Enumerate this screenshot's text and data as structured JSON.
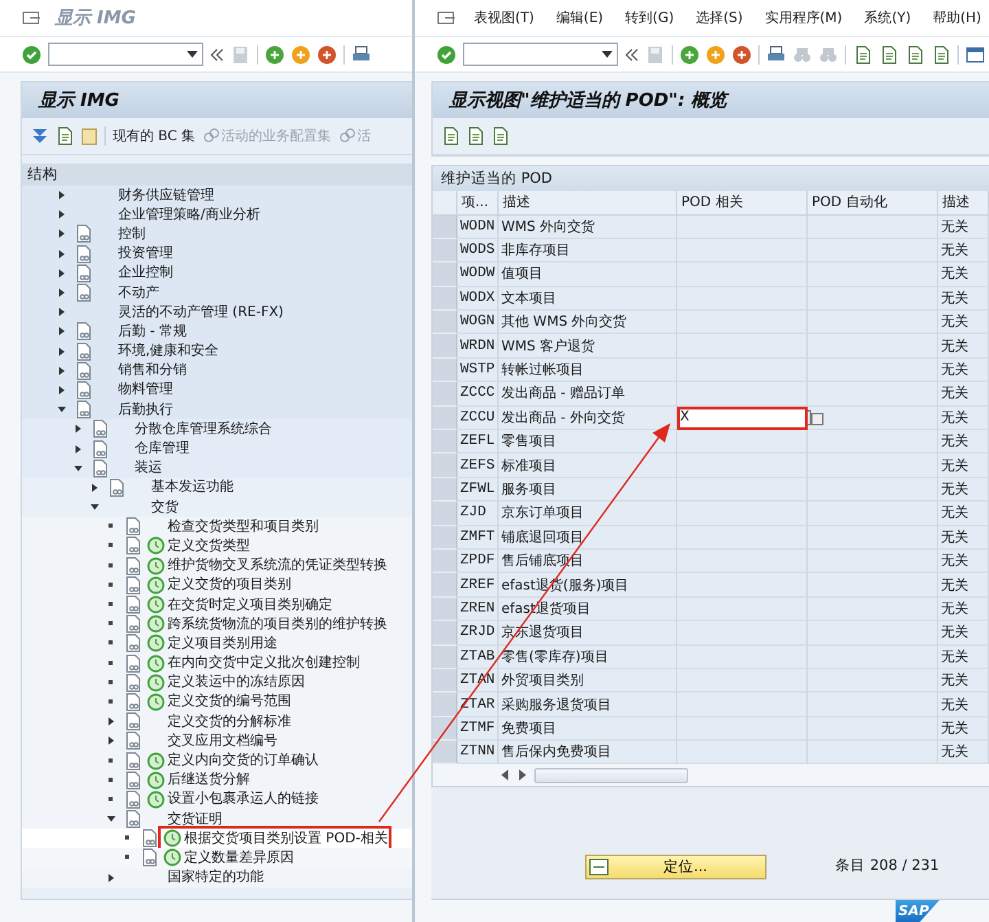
{
  "left_window": {
    "title": "显示 IMG",
    "panel_title": "显示 IMG",
    "toolbar": [
      {
        "label": "现有的 BC 集",
        "disabled": false
      },
      {
        "label": "活动的业务配置集",
        "disabled": true
      },
      {
        "label": "活",
        "disabled": true
      }
    ],
    "structure_label": "结构",
    "tree": [
      {
        "label": "财务供应链管理",
        "kind": "node",
        "expanded": false,
        "doc": false,
        "execute": false,
        "highlighted": false
      },
      {
        "label": "企业管理策略/商业分析",
        "kind": "node",
        "expanded": false,
        "doc": false,
        "execute": false,
        "highlighted": false
      },
      {
        "label": "控制",
        "kind": "node",
        "expanded": false,
        "doc": true,
        "execute": false,
        "highlighted": false
      },
      {
        "label": "投资管理",
        "kind": "node",
        "expanded": false,
        "doc": true,
        "execute": false,
        "highlighted": false
      },
      {
        "label": "企业控制",
        "kind": "node",
        "expanded": false,
        "doc": true,
        "execute": false,
        "highlighted": false
      },
      {
        "label": "不动产",
        "kind": "node",
        "expanded": false,
        "doc": true,
        "execute": false,
        "highlighted": false
      },
      {
        "label": "灵活的不动产管理 (RE-FX)",
        "kind": "node",
        "expanded": false,
        "doc": false,
        "execute": false,
        "highlighted": false
      },
      {
        "label": "后勤 - 常规",
        "kind": "node",
        "expanded": false,
        "doc": true,
        "execute": false,
        "highlighted": false
      },
      {
        "label": "环境,健康和安全",
        "kind": "node",
        "expanded": false,
        "doc": true,
        "execute": false,
        "highlighted": false
      },
      {
        "label": "销售和分销",
        "kind": "node",
        "expanded": false,
        "doc": true,
        "execute": false,
        "highlighted": false
      },
      {
        "label": "物料管理",
        "kind": "node",
        "expanded": false,
        "doc": true,
        "execute": false,
        "highlighted": false
      },
      {
        "label": "后勤执行",
        "kind": "node",
        "expanded": true,
        "doc": true,
        "execute": false,
        "highlighted": false,
        "children": [
          {
            "label": "分散仓库管理系统综合",
            "kind": "node",
            "expanded": false,
            "doc": true,
            "execute": false,
            "highlighted": false
          },
          {
            "label": "仓库管理",
            "kind": "node",
            "expanded": false,
            "doc": true,
            "execute": false,
            "highlighted": false
          },
          {
            "label": "装运",
            "kind": "node",
            "expanded": true,
            "doc": true,
            "execute": false,
            "highlighted": false,
            "children": [
              {
                "label": "基本发运功能",
                "kind": "node",
                "expanded": false,
                "doc": true,
                "execute": false,
                "highlighted": false
              },
              {
                "label": "交货",
                "kind": "node",
                "expanded": true,
                "doc": false,
                "execute": false,
                "highlighted": false,
                "children": [
                  {
                    "label": "检查交货类型和项目类别",
                    "kind": "leaf",
                    "doc": true,
                    "execute": false,
                    "highlighted": false
                  },
                  {
                    "label": "定义交货类型",
                    "kind": "leaf",
                    "doc": true,
                    "execute": true,
                    "highlighted": false
                  },
                  {
                    "label": "维护货物交叉系统流的凭证类型转换",
                    "kind": "leaf",
                    "doc": true,
                    "execute": true,
                    "highlighted": false
                  },
                  {
                    "label": "定义交货的项目类别",
                    "kind": "leaf",
                    "doc": true,
                    "execute": true,
                    "highlighted": false
                  },
                  {
                    "label": "在交货时定义项目类别确定",
                    "kind": "leaf",
                    "doc": true,
                    "execute": true,
                    "highlighted": false
                  },
                  {
                    "label": "跨系统货物流的项目类别的维护转换",
                    "kind": "leaf",
                    "doc": true,
                    "execute": true,
                    "highlighted": false
                  },
                  {
                    "label": "定义项目类别用途",
                    "kind": "leaf",
                    "doc": true,
                    "execute": true,
                    "highlighted": false
                  },
                  {
                    "label": "在内向交货中定义批次创建控制",
                    "kind": "leaf",
                    "doc": true,
                    "execute": true,
                    "highlighted": false
                  },
                  {
                    "label": "定义装运中的冻结原因",
                    "kind": "leaf",
                    "doc": true,
                    "execute": true,
                    "highlighted": false
                  },
                  {
                    "label": "定义交货的编号范围",
                    "kind": "leaf",
                    "doc": true,
                    "execute": true,
                    "highlighted": false
                  },
                  {
                    "label": "定义交货的分解标准",
                    "kind": "node",
                    "expanded": false,
                    "doc": true,
                    "execute": false,
                    "highlighted": false
                  },
                  {
                    "label": "交叉应用文档编号",
                    "kind": "node",
                    "expanded": false,
                    "doc": true,
                    "execute": false,
                    "highlighted": false
                  },
                  {
                    "label": "定义内向交货的订单确认",
                    "kind": "leaf",
                    "doc": true,
                    "execute": true,
                    "highlighted": false
                  },
                  {
                    "label": "后继送货分解",
                    "kind": "leaf",
                    "doc": true,
                    "execute": true,
                    "highlighted": false
                  },
                  {
                    "label": "设置小包裹承运人的链接",
                    "kind": "leaf",
                    "doc": true,
                    "execute": true,
                    "highlighted": false
                  },
                  {
                    "label": "交货证明",
                    "kind": "node",
                    "expanded": true,
                    "doc": true,
                    "execute": false,
                    "highlighted": false,
                    "children": [
                      {
                        "label": "根据交货项目类别设置 POD-相关",
                        "kind": "leaf",
                        "doc": true,
                        "execute": true,
                        "highlighted": true
                      },
                      {
                        "label": "定义数量差异原因",
                        "kind": "leaf",
                        "doc": true,
                        "execute": true,
                        "highlighted": false
                      }
                    ]
                  },
                  {
                    "label": "国家特定的功能",
                    "kind": "node",
                    "expanded": false,
                    "doc": false,
                    "execute": false,
                    "highlighted": false
                  }
                ]
              }
            ]
          }
        ]
      }
    ]
  },
  "right_window": {
    "menu": [
      "表视图(T)",
      "编辑(E)",
      "转到(G)",
      "选择(S)",
      "实用程序(M)",
      "系统(Y)",
      "帮助(H)"
    ],
    "title": "显示视图\"维护适当的 POD\": 概览",
    "table": {
      "title": "维护适当的 POD",
      "columns": [
        "项...",
        "描述",
        "POD 相关",
        "POD 自动化",
        "描述"
      ],
      "rows": [
        {
          "item": "WODN",
          "description": "WMS 外向交货",
          "column_5": "无关",
          "highlighted": false
        },
        {
          "item": "WODS",
          "description": "非库存项目",
          "column_5": "无关",
          "highlighted": false
        },
        {
          "item": "WODW",
          "description": "值项目",
          "column_5": "无关",
          "highlighted": false
        },
        {
          "item": "WODX",
          "description": "文本项目",
          "column_5": "无关",
          "highlighted": false
        },
        {
          "item": "WOGN",
          "description": "其他 WMS 外向交货",
          "column_5": "无关",
          "highlighted": false
        },
        {
          "item": "WRDN",
          "description": "WMS 客户退货",
          "column_5": "无关",
          "highlighted": false
        },
        {
          "item": "WSTP",
          "description": "转帐过帐项目",
          "column_5": "无关",
          "highlighted": false
        },
        {
          "item": "ZCCC",
          "description": "发出商品 - 赠品订单",
          "column_5": "无关",
          "highlighted": false
        },
        {
          "item": "ZCCU",
          "description": "发出商品 - 外向交货",
          "pod_relevant": "X",
          "column_5": "无关",
          "highlighted": true
        },
        {
          "item": "ZEFL",
          "description": "零售项目",
          "column_5": "无关",
          "highlighted": false
        },
        {
          "item": "ZEFS",
          "description": "标准项目",
          "column_5": "无关",
          "highlighted": false
        },
        {
          "item": "ZFWL",
          "description": "服务项目",
          "column_5": "无关",
          "highlighted": false
        },
        {
          "item": "ZJD",
          "description": "京东订单项目",
          "column_5": "无关",
          "highlighted": false
        },
        {
          "item": "ZMFT",
          "description": "铺底退回项目",
          "column_5": "无关",
          "highlighted": false
        },
        {
          "item": "ZPDF",
          "description": "售后铺底项目",
          "column_5": "无关",
          "highlighted": false
        },
        {
          "item": "ZREF",
          "description": "efast退货(服务)项目",
          "column_5": "无关",
          "highlighted": false
        },
        {
          "item": "ZREN",
          "description": "efast退货项目",
          "column_5": "无关",
          "highlighted": false
        },
        {
          "item": "ZRJD",
          "description": "京东退货项目",
          "column_5": "无关",
          "highlighted": false
        },
        {
          "item": "ZTAB",
          "description": "零售(零库存)项目",
          "column_5": "无关",
          "highlighted": false
        },
        {
          "item": "ZTAN",
          "description": "外贸项目类别",
          "column_5": "无关",
          "highlighted": false
        },
        {
          "item": "ZTAR",
          "description": "采购服务退货项目",
          "column_5": "无关",
          "highlighted": false
        },
        {
          "item": "ZTMF",
          "description": "免费项目",
          "column_5": "无关",
          "highlighted": false
        },
        {
          "item": "ZTNN",
          "description": "售后保内免费项目",
          "column_5": "无关",
          "highlighted": false
        }
      ]
    },
    "position_button": "定位...",
    "entry_count": "条目 208 / 231",
    "logo": "SAP"
  }
}
